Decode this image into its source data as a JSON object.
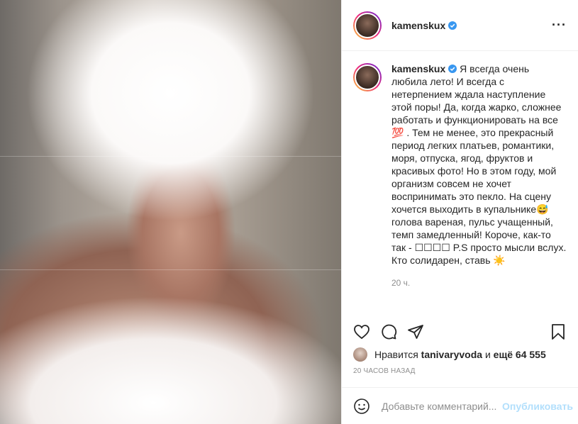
{
  "post": {
    "username": "kamenskux",
    "caption": "Я всегда очень любила лето! И всегда с нетерпением ждала наступление этой поры! Да, когда жарко, сложнее работать и функционировать на все 💯 . Тем не менее, это прекрасный период легких платьев, романтики, моря, отпуска, ягод, фруктов и красивых фото! Но в этом году, мой организм совсем не хочет воспринимать это пекло. На сцену хочется выходить в купальнике😅 голова вареная, пульс учащенный, темп замедленный! Короче, как-то так - ☐☐☐☐ P.S просто мысли вслух. Кто солидарен, ставь ☀️",
    "caption_time": "20 ч.",
    "likes_prefix": "Нравится",
    "liked_by": "tanivaryvoda",
    "likes_middle": "и",
    "likes_count": "ещё 64 555",
    "timestamp": "20 ЧАСОВ НАЗАД"
  },
  "comment": {
    "placeholder": "Добавьте комментарий...",
    "publish_label": "Опубликовать"
  },
  "icons": {
    "more": "more-icon",
    "verified": "verified-badge-icon",
    "like": "heart-icon",
    "comment": "comment-icon",
    "share": "share-icon",
    "save": "bookmark-icon",
    "emoji": "emoji-icon"
  },
  "colors": {
    "verified": "#3897f0",
    "publish_disabled": "#b2dffc",
    "muted_text": "#8e8e8e"
  }
}
